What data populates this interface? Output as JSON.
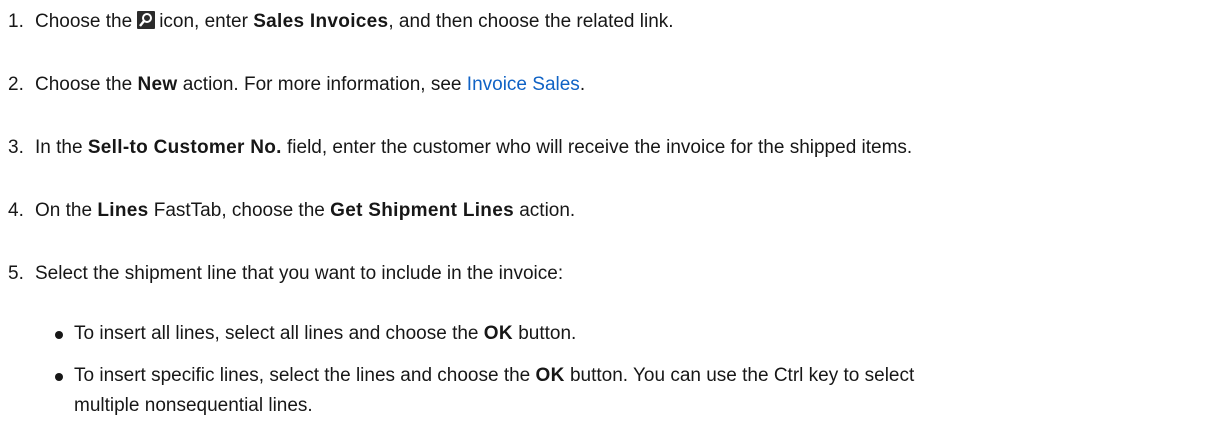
{
  "steps": [
    {
      "num": "1.",
      "a": "Choose the",
      "icon": "search-icon",
      "b": "icon, enter",
      "bold": "Sales Invoices",
      "c": ", and then choose the related link."
    },
    {
      "num": "2.",
      "a": "Choose the",
      "bold": "New",
      "b": "action. For more information, see",
      "link": "Invoice Sales",
      "c": "."
    },
    {
      "num": "3.",
      "a": "In the",
      "bold": "Sell-to Customer No.",
      "b": "field, enter the customer who will receive the invoice for the shipped items."
    },
    {
      "num": "4.",
      "a": "On the",
      "bold1": "Lines",
      "b": "FastTab, choose the",
      "bold2": "Get Shipment Lines",
      "c": "action."
    },
    {
      "num": "5.",
      "a": "Select the shipment line that you want to include in the invoice:"
    }
  ],
  "bullets": [
    {
      "a": "To insert all lines, select all lines and choose the",
      "bold": "OK",
      "b": "button."
    },
    {
      "a": "To insert specific lines, select the lines and choose the",
      "bold": "OK",
      "b": "button. You can use the Ctrl key to select",
      "cont": "multiple nonsequential lines."
    }
  ]
}
